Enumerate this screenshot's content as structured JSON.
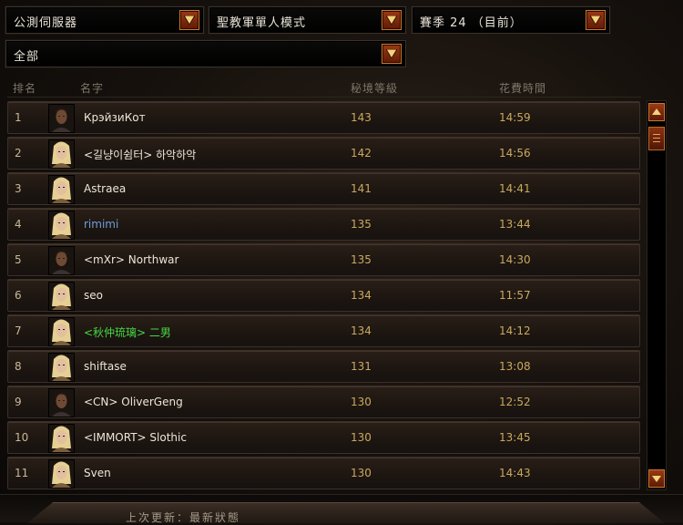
{
  "filters": {
    "server": "公測伺服器",
    "mode": "聖教軍單人模式",
    "season": "賽季 24 （目前）",
    "category": "全部"
  },
  "columns": {
    "rank": "排名",
    "name": "名字",
    "level": "秘境等級",
    "time": "花費時間"
  },
  "rows": [
    {
      "rank": "1",
      "name": "КрэйзиКот",
      "level": "143",
      "time": "14:59",
      "avatar": "male",
      "name_color": "#ece6d8"
    },
    {
      "rank": "2",
      "name": "<길냥이쉼터> 하악하악",
      "level": "142",
      "time": "14:56",
      "avatar": "female",
      "name_color": "#ece6d8"
    },
    {
      "rank": "3",
      "name": "Astraea",
      "level": "141",
      "time": "14:41",
      "avatar": "female",
      "name_color": "#ece6d8"
    },
    {
      "rank": "4",
      "name": "rimimi",
      "level": "135",
      "time": "13:44",
      "avatar": "female",
      "name_color": "#6f9fdd"
    },
    {
      "rank": "5",
      "name": "<mXr> Northwar",
      "level": "135",
      "time": "14:30",
      "avatar": "male",
      "name_color": "#ece6d8"
    },
    {
      "rank": "6",
      "name": "seo",
      "level": "134",
      "time": "11:57",
      "avatar": "female",
      "name_color": "#ece6d8"
    },
    {
      "rank": "7",
      "name": "<秋仲琉璃> 二男",
      "level": "134",
      "time": "14:12",
      "avatar": "female",
      "name_color": "#46d844"
    },
    {
      "rank": "8",
      "name": "shiftase",
      "level": "131",
      "time": "13:08",
      "avatar": "female",
      "name_color": "#ece6d8"
    },
    {
      "rank": "9",
      "name": "<CN> OliverGeng",
      "level": "130",
      "time": "12:52",
      "avatar": "male",
      "name_color": "#ece6d8"
    },
    {
      "rank": "10",
      "name": "<IMMORT> Slothic",
      "level": "130",
      "time": "13:45",
      "avatar": "female",
      "name_color": "#ece6d8"
    },
    {
      "rank": "11",
      "name": "Sven",
      "level": "130",
      "time": "14:43",
      "avatar": "female",
      "name_color": "#ece6d8"
    }
  ],
  "footer": {
    "last_update": "上次更新：最新狀態"
  },
  "icons": {
    "dropdown": "chevron-down-icon",
    "scroll_up": "arrow-up-icon",
    "scroll_down": "arrow-down-icon"
  },
  "colors": {
    "accent": "#9a3a14",
    "level_text": "#c9a95f"
  }
}
